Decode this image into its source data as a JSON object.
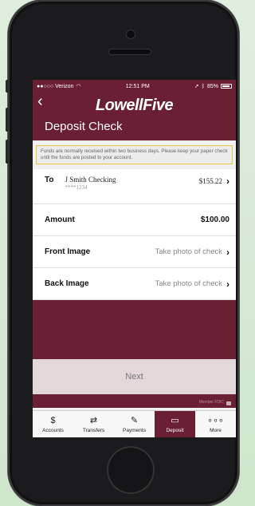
{
  "status": {
    "carrier": "●●○○○ Verizon",
    "time": "12:51 PM",
    "battery": "85%"
  },
  "header": {
    "back_icon": "chevron-left-icon",
    "logo": "LowellFive",
    "title": "Deposit Check"
  },
  "notice": "Funds are normally received within two business days. Please keep your paper check until the funds are posted to your account.",
  "to_row": {
    "label": "To",
    "account_name": "J Smith Checking",
    "account_number": "****1234",
    "balance": "$155.22"
  },
  "amount_row": {
    "label": "Amount",
    "value": "$100.00"
  },
  "front_row": {
    "label": "Front Image",
    "hint": "Take photo of check"
  },
  "back_row": {
    "label": "Back Image",
    "hint": "Take photo of check"
  },
  "next_button": "Next",
  "member_fdic": "Member FDIC",
  "tabs": [
    {
      "label": "Accounts",
      "icon": "dollar-icon"
    },
    {
      "label": "Transfers",
      "icon": "transfer-icon"
    },
    {
      "label": "Payments",
      "icon": "payments-icon"
    },
    {
      "label": "Deposit",
      "icon": "deposit-icon"
    },
    {
      "label": "More",
      "icon": "more-icon"
    }
  ],
  "colors": {
    "brand": "#6b1f33",
    "notice_border": "#e6c83a"
  }
}
